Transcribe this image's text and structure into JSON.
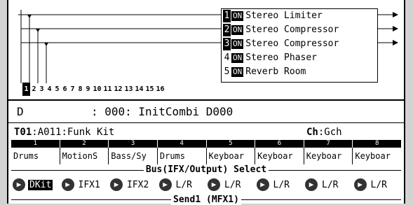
{
  "ifx_slots": [
    {
      "num": "1",
      "on": "ON",
      "name": "Stereo Limiter"
    },
    {
      "num": "2",
      "on": "ON",
      "name": "Stereo Compressor"
    },
    {
      "num": "3",
      "on": "ON",
      "name": "Stereo Compressor"
    },
    {
      "num": "4",
      "on": "ON",
      "name": "Stereo Phaser"
    },
    {
      "num": "5",
      "on": "ON",
      "name": "Reverb Room"
    }
  ],
  "channels": [
    "1",
    "2",
    "3",
    "4",
    "5",
    "6",
    "7",
    "8",
    "9",
    "10",
    "11",
    "12",
    "13",
    "14",
    "15",
    "16"
  ],
  "combi": {
    "bank": "D",
    "line": "D          : 000: InitCombi D000"
  },
  "timbre_info": {
    "timbre": "T01",
    "program": ":A011:Funk Kit",
    "ch_label": "Ch",
    "ch_value": ":Gch"
  },
  "timbres": [
    {
      "num": "1",
      "program": "Drums",
      "bus": "DKit"
    },
    {
      "num": "2",
      "program": "MotionS",
      "bus": "IFX1"
    },
    {
      "num": "3",
      "program": "Bass/Sy",
      "bus": "IFX2"
    },
    {
      "num": "4",
      "program": "Drums",
      "bus": "L/R"
    },
    {
      "num": "5",
      "program": "Keyboar",
      "bus": "L/R"
    },
    {
      "num": "6",
      "program": "Keyboar",
      "bus": "L/R"
    },
    {
      "num": "7",
      "program": "Keyboar",
      "bus": "L/R"
    },
    {
      "num": "8",
      "program": "Keyboar",
      "bus": "L/R"
    }
  ],
  "bus_select_label": "Bus(IFX/Output) Select",
  "send1_label": "Send1 (MFX1)"
}
